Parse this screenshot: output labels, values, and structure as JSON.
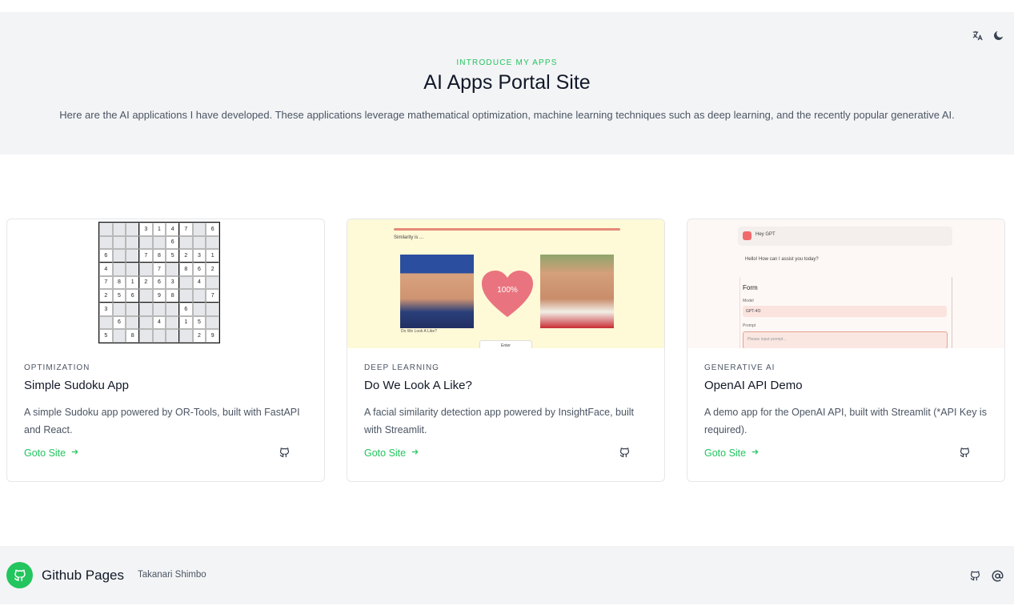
{
  "hero": {
    "eyebrow": "INTRODUCE MY APPS",
    "title": "AI Apps Portal Site",
    "description": "Here are the AI applications I have developed. These applications leverage mathematical optimization, machine learning techniques such as deep learning, and the recently popular generative AI."
  },
  "toolbar": {
    "translate_icon": "translate-icon",
    "theme_icon": "moon-icon"
  },
  "cards": [
    {
      "category": "OPTIMIZATION",
      "title": "Simple Sudoku App",
      "description": "A simple Sudoku app powered by OR-Tools, built with FastAPI and React.",
      "link_label": "Goto Site"
    },
    {
      "category": "DEEP LEARNING",
      "title": "Do We Look A Like?",
      "description": "A facial similarity detection app powered by InsightFace, built with Streamlit.",
      "link_label": "Goto Site"
    },
    {
      "category": "GENERATIVE AI",
      "title": "OpenAI API Demo",
      "description": "A demo app for the OpenAI API, built with Streamlit (*API Key is required).",
      "link_label": "Goto Site"
    }
  ],
  "sudoku": {
    "grid": [
      [
        "",
        "",
        "",
        "3",
        "1",
        "4",
        "7",
        "",
        "6"
      ],
      [
        "",
        "",
        "",
        "",
        "",
        "6",
        "",
        "",
        ""
      ],
      [
        "6",
        "",
        "",
        "7",
        "8",
        "5",
        "2",
        "3",
        "1"
      ],
      [
        "4",
        "",
        "",
        "",
        "7",
        "",
        "8",
        "6",
        "2"
      ],
      [
        "7",
        "8",
        "1",
        "2",
        "6",
        "3",
        "",
        "4",
        ""
      ],
      [
        "2",
        "5",
        "6",
        "",
        "9",
        "8",
        "",
        "",
        "7"
      ],
      [
        "3",
        "",
        "",
        "",
        "",
        "",
        "6",
        "",
        ""
      ],
      [
        "",
        "6",
        "",
        "",
        "4",
        "",
        "1",
        "5",
        ""
      ],
      [
        "5",
        "",
        "8",
        "",
        "",
        "",
        "",
        "2",
        "9"
      ]
    ]
  },
  "similarity_preview": {
    "label": "Similarity is ...",
    "score": "100%",
    "caption": "Do We Look A Like?",
    "button": "Enter"
  },
  "openai_preview": {
    "bot_name": "Hey GPT",
    "greeting": "Hello! How can I assist you today?",
    "form_title": "Form",
    "model_label": "Model",
    "model_value": "GPT-4O",
    "prompt_label": "Prompt",
    "prompt_placeholder": "Please input prompt..."
  },
  "footer": {
    "brand": "Github Pages",
    "author": "Takanari Shimbo"
  },
  "colors": {
    "accent": "#22c55e",
    "panel": "#f3f4f6",
    "heart": "#e9747f"
  }
}
